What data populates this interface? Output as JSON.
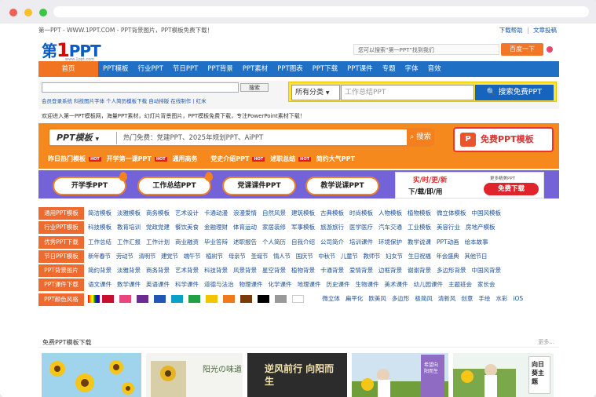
{
  "topbar": {
    "left": "第一PPT - WWW.1PPT.COM - PPT背景图片，PPT模板免费下载！",
    "download_help": "下载帮助",
    "sep": "|",
    "contribute": "文章投稿"
  },
  "logo": {
    "pre": "第",
    "one": "1",
    "post": "PPT",
    "sub": "www.1ppt.com"
  },
  "header_search": {
    "placeholder": "您可以搜索“第一PPT”找到我们",
    "button": "百度一下"
  },
  "nav": [
    "首页",
    "PPT模板",
    "行业PPT",
    "节日PPT",
    "PPT背景",
    "PPT素材",
    "PPT图表",
    "PPT下载",
    "PPT课件",
    "专题",
    "字体",
    "音效"
  ],
  "site_search": {
    "button": "搜索",
    "links": "会员登录系统 科技图片字体 个人简历模板下载 自动排版 在线制作 | 红米",
    "category": "所有分类",
    "placeholder": "工作总结PPT",
    "big_button": "搜索免费PPT"
  },
  "welcome": "欢迎进入第一PPT模板网，海量PPT素材，幻灯片背景图片，PPT模板免费下载，专注PowerPoint素材下载！",
  "main_search": {
    "category": "PPT模板",
    "placeholder": "热门免费：党建PPT、2025年规划PPT、AiPPT",
    "button": "搜索",
    "promo": "免费PPT模板",
    "promo_icon": "P",
    "hot_badge": "HOT",
    "hot_links": [
      "昨日热门模板",
      "开学第一课PPT",
      "通用商务",
      "党史介绍PPT",
      "述职总结",
      "简约大气PPT"
    ]
  },
  "pills": [
    "开学季PPT",
    "工作总结PPT",
    "党课课件PPT",
    "教学说课PPT"
  ],
  "ad": {
    "line1": "实/时/更/新",
    "line2": "下/载/即/用",
    "more": "更多精美PPT",
    "button": "免费下载"
  },
  "categories": [
    {
      "label": "通用PPT模板",
      "links": [
        "简洁模板",
        "淡雅模板",
        "商务模板",
        "艺术设计",
        "卡通动漫",
        "浪漫爱情",
        "自然风景",
        "建筑模板",
        "古典模板",
        "时尚模板",
        "人物模板",
        "植物模板",
        "微立体模板",
        "中国风模板"
      ]
    },
    {
      "label": "行业PPT模板",
      "links": [
        "科技模板",
        "教育培训",
        "党政党建",
        "餐饮美食",
        "金融理财",
        "体育运动",
        "家居装修",
        "军事模板",
        "旅游旅行",
        "医学医疗",
        "汽车交通",
        "工业模板",
        "美容行业",
        "房地产模板"
      ]
    },
    {
      "label": "优秀PPT下载",
      "links": [
        "工作总结",
        "工作汇报",
        "工作计划",
        "商业融资",
        "毕业答辩",
        "述职报告",
        "个人简历",
        "自我介绍",
        "公司简介",
        "培训课件",
        "环境保护",
        "教学说课",
        "PPT动画",
        "绘本故事"
      ]
    },
    {
      "label": "节日PPT模板",
      "links": [
        "新年春节",
        "劳动节",
        "清明节",
        "建党节",
        "端午节",
        "植树节",
        "母亲节",
        "圣诞节",
        "情人节",
        "国庆节",
        "中秋节",
        "儿童节",
        "教师节",
        "妇女节",
        "生日祝福",
        "年会盛典",
        "其他节日"
      ]
    },
    {
      "label": "PPT背景图片",
      "links": [
        "简约背景",
        "淡雅背景",
        "商务背景",
        "艺术背景",
        "科技背景",
        "风景背景",
        "星空背景",
        "植物背景",
        "卡通背景",
        "爱情背景",
        "边框背景",
        "谢谢背景",
        "多边形背景",
        "中国风背景"
      ]
    },
    {
      "label": "PPT课件下载",
      "links": [
        "语文课件",
        "数学课件",
        "英语课件",
        "科学课件",
        "道德与法治",
        "物理课件",
        "化学课件",
        "地理课件",
        "历史课件",
        "生物课件",
        "美术课件",
        "幼儿园课件",
        "主题班会",
        "家长会"
      ]
    },
    {
      "label": "PPT颜色风格",
      "links": [
        "微立体",
        "扁平化",
        "欧美风",
        "多边形",
        "极简风",
        "清新风",
        "创意",
        "手绘",
        "水彩",
        "iOS"
      ]
    }
  ],
  "color_swatches": [
    "rainbow",
    "#c8102e",
    "#e8467c",
    "#6a2c91",
    "#2156b8",
    "#0aa0c8",
    "#22a045",
    "#f2c500",
    "#f07a1a",
    "#7a3a0a",
    "#000000",
    "#999999",
    "#ffffff"
  ],
  "section": {
    "title": "免费PPT模板下载",
    "more": "更多..."
  },
  "thumb_texts": [
    "阳光の味道",
    "逆风前行 向阳而生",
    "希望向阳而生",
    "向日葵主题"
  ]
}
